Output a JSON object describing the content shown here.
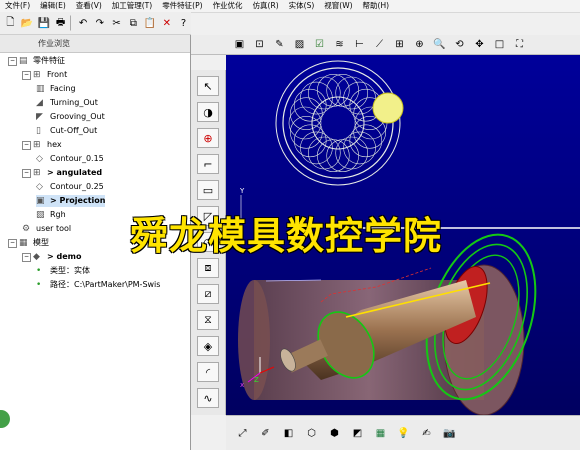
{
  "menu": [
    "文件(F)",
    "编辑(E)",
    "查看(V)",
    "加工管理(T)",
    "零件特征(P)",
    "作业优化",
    "仿真(R)",
    "实体(S)",
    "视窗(W)",
    "帮助(H)"
  ],
  "panel": {
    "title": "作业浏览",
    "tree": [
      {
        "label": "零件特征",
        "level": 0,
        "bold": false,
        "icon": "folder-icon"
      },
      {
        "label": "Front",
        "level": 1,
        "bold": false,
        "icon": "group-icon"
      },
      {
        "label": "Facing",
        "level": 2,
        "bold": false,
        "icon": "facing-icon"
      },
      {
        "label": "Turning_Out",
        "level": 2,
        "bold": false,
        "icon": "turning-icon"
      },
      {
        "label": "Grooving_Out",
        "level": 2,
        "bold": false,
        "icon": "grooving-icon"
      },
      {
        "label": "Cut-Off_Out",
        "level": 2,
        "bold": false,
        "icon": "cutoff-icon"
      },
      {
        "label": "hex",
        "level": 1,
        "bold": false,
        "icon": "group-icon"
      },
      {
        "label": "Contour_0.15",
        "level": 2,
        "bold": false,
        "icon": "contour-icon"
      },
      {
        "label": "> angulated",
        "level": 1,
        "bold": true,
        "icon": "group-icon"
      },
      {
        "label": "Contour_0.25",
        "level": 2,
        "bold": false,
        "icon": "contour-icon"
      },
      {
        "label": "> Projection",
        "level": 2,
        "bold": true,
        "icon": "projection-icon",
        "selected": true
      },
      {
        "label": "Rgh",
        "level": 2,
        "bold": false,
        "icon": "rough-icon"
      },
      {
        "label": "user tool",
        "level": 1,
        "bold": false,
        "icon": "tool-icon"
      },
      {
        "label": "模型",
        "level": 0,
        "bold": false,
        "icon": "model-icon"
      },
      {
        "label": "> demo",
        "level": 1,
        "bold": true,
        "icon": "part-icon"
      },
      {
        "label": "类型：实体",
        "level": 2,
        "bold": false,
        "icon": "bullet-icon"
      },
      {
        "label": "路径：C:\\PartMaker\\PM-Swis",
        "level": 2,
        "bold": false,
        "icon": "bullet-icon"
      }
    ]
  },
  "toolbar_icons": [
    "new-icon",
    "open-icon",
    "save-icon",
    "print-icon",
    "undo-icon",
    "redo-icon",
    "cut-icon",
    "copy-icon",
    "paste-icon",
    "delete-icon",
    "help-icon"
  ],
  "watermark": "舜龙模具数控学院"
}
